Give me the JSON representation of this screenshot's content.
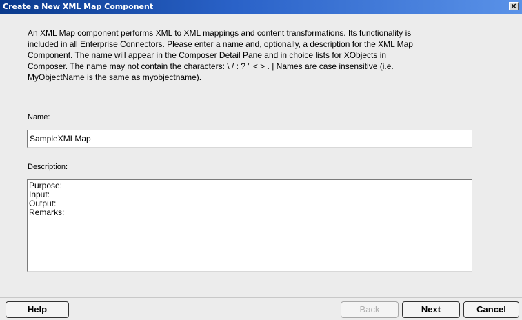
{
  "window": {
    "title": "Create a New XML Map Component",
    "close_label": "×"
  },
  "intro": {
    "lines": [
      "An XML Map component performs XML to XML mappings and content transformations. Its functionality is",
      "included in all Enterprise Connectors. Please enter a name and, optionally, a description for the XML Map",
      "Component. The name will appear in the Composer Detail Pane and in choice lists for XObjects in",
      "Composer. The name may not contain the characters: \\ / : ? \" < > . |  Names are case insensitive (i.e.",
      "MyObjectName is the same as myobjectname)."
    ]
  },
  "name_field": {
    "label": "Name:",
    "value": "SampleXMLMap"
  },
  "description_field": {
    "label": "Description:",
    "lines": [
      "Purpose:",
      "Input:",
      "Output:",
      "Remarks:"
    ]
  },
  "buttons": {
    "help": "Help",
    "back": "Back",
    "next": "Next",
    "cancel": "Cancel"
  }
}
